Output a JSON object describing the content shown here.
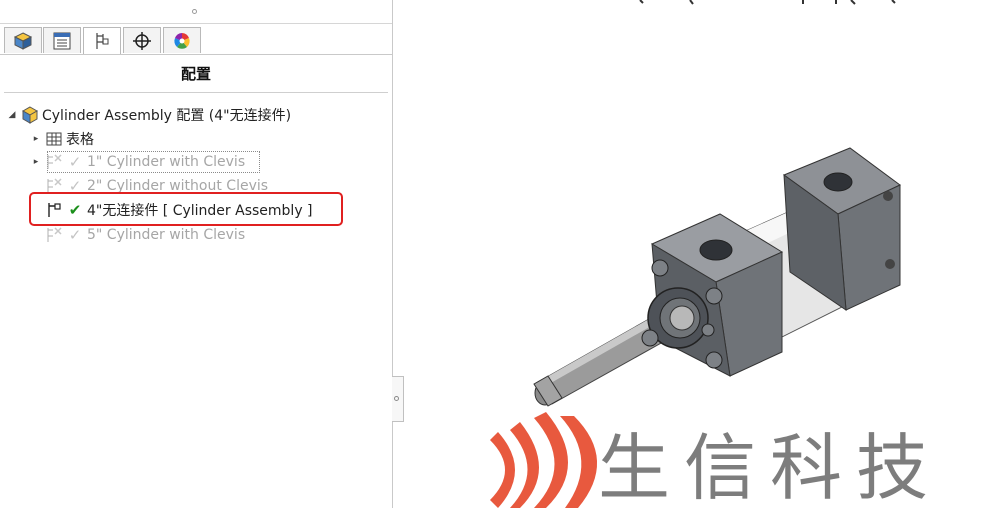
{
  "panel": {
    "title": "配置",
    "tabs": [
      {
        "name": "featuremanager-tab",
        "icon": "feature-tree-icon"
      },
      {
        "name": "propertymanager-tab",
        "icon": "property-list-icon"
      },
      {
        "name": "configurationmanager-tab",
        "icon": "configuration-icon",
        "active": true
      },
      {
        "name": "dimxpert-tab",
        "icon": "crosshair-icon"
      },
      {
        "name": "appearance-tab",
        "icon": "color-wheel-icon"
      }
    ],
    "tree": {
      "root": {
        "label": "Cylinder Assembly 配置 (4\"无连接件)"
      },
      "tables": {
        "label": "表格"
      },
      "configs": [
        {
          "label": "1\" Cylinder with Clevis",
          "active": false
        },
        {
          "label": "2\" Cylinder without Clevis",
          "active": false
        },
        {
          "label": "4\"无连接件 [ Cylinder Assembly ]",
          "active": true
        },
        {
          "label": "5\" Cylinder with Clevis",
          "active": false
        }
      ]
    }
  },
  "watermark": {
    "text": "生信科技",
    "logo_color": "#e8593e",
    "text_color": "#7d7d7d"
  },
  "colors": {
    "highlight": "#e02020",
    "check_active": "#1b8f1b",
    "cylinder_body": "#6f7378"
  }
}
